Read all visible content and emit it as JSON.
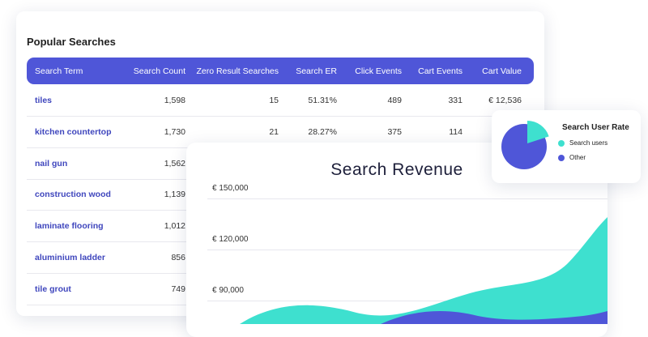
{
  "table": {
    "title": "Popular Searches",
    "columns": [
      "Search Term",
      "Search Count",
      "Zero Result Searches",
      "Search ER",
      "Click Events",
      "Cart Events",
      "Cart Value"
    ],
    "rows": [
      [
        "tiles",
        "1,598",
        "15",
        "51.31%",
        "489",
        "331",
        "€ 12,536"
      ],
      [
        "kitchen countertop",
        "1,730",
        "21",
        "28.27%",
        "375",
        "114",
        ""
      ],
      [
        "nail gun",
        "1,562",
        "",
        "",
        "",
        "",
        ""
      ],
      [
        "construction wood",
        "1,139",
        "",
        "",
        "",
        "",
        ""
      ],
      [
        "laminate flooring",
        "1,012",
        "",
        "",
        "",
        "",
        ""
      ],
      [
        "aluminium ladder",
        "856",
        "",
        "",
        "",
        "",
        ""
      ],
      [
        "tile grout",
        "749",
        "",
        "",
        "",
        "",
        ""
      ]
    ]
  },
  "revenue": {
    "title": "Search Revenue",
    "yticks": [
      "€ 150,000",
      "€ 120,000",
      "€ 90,000"
    ]
  },
  "pie": {
    "title": "Search User Rate",
    "legend": [
      "Search users",
      "Other"
    ],
    "search_users_share": 0.2,
    "colors": {
      "search_users": "#3ee0cf",
      "other": "#4f56d8"
    }
  },
  "colors": {
    "header": "#4f56d8",
    "teal": "#3ee0cf",
    "indigo": "#4f56d8"
  }
}
